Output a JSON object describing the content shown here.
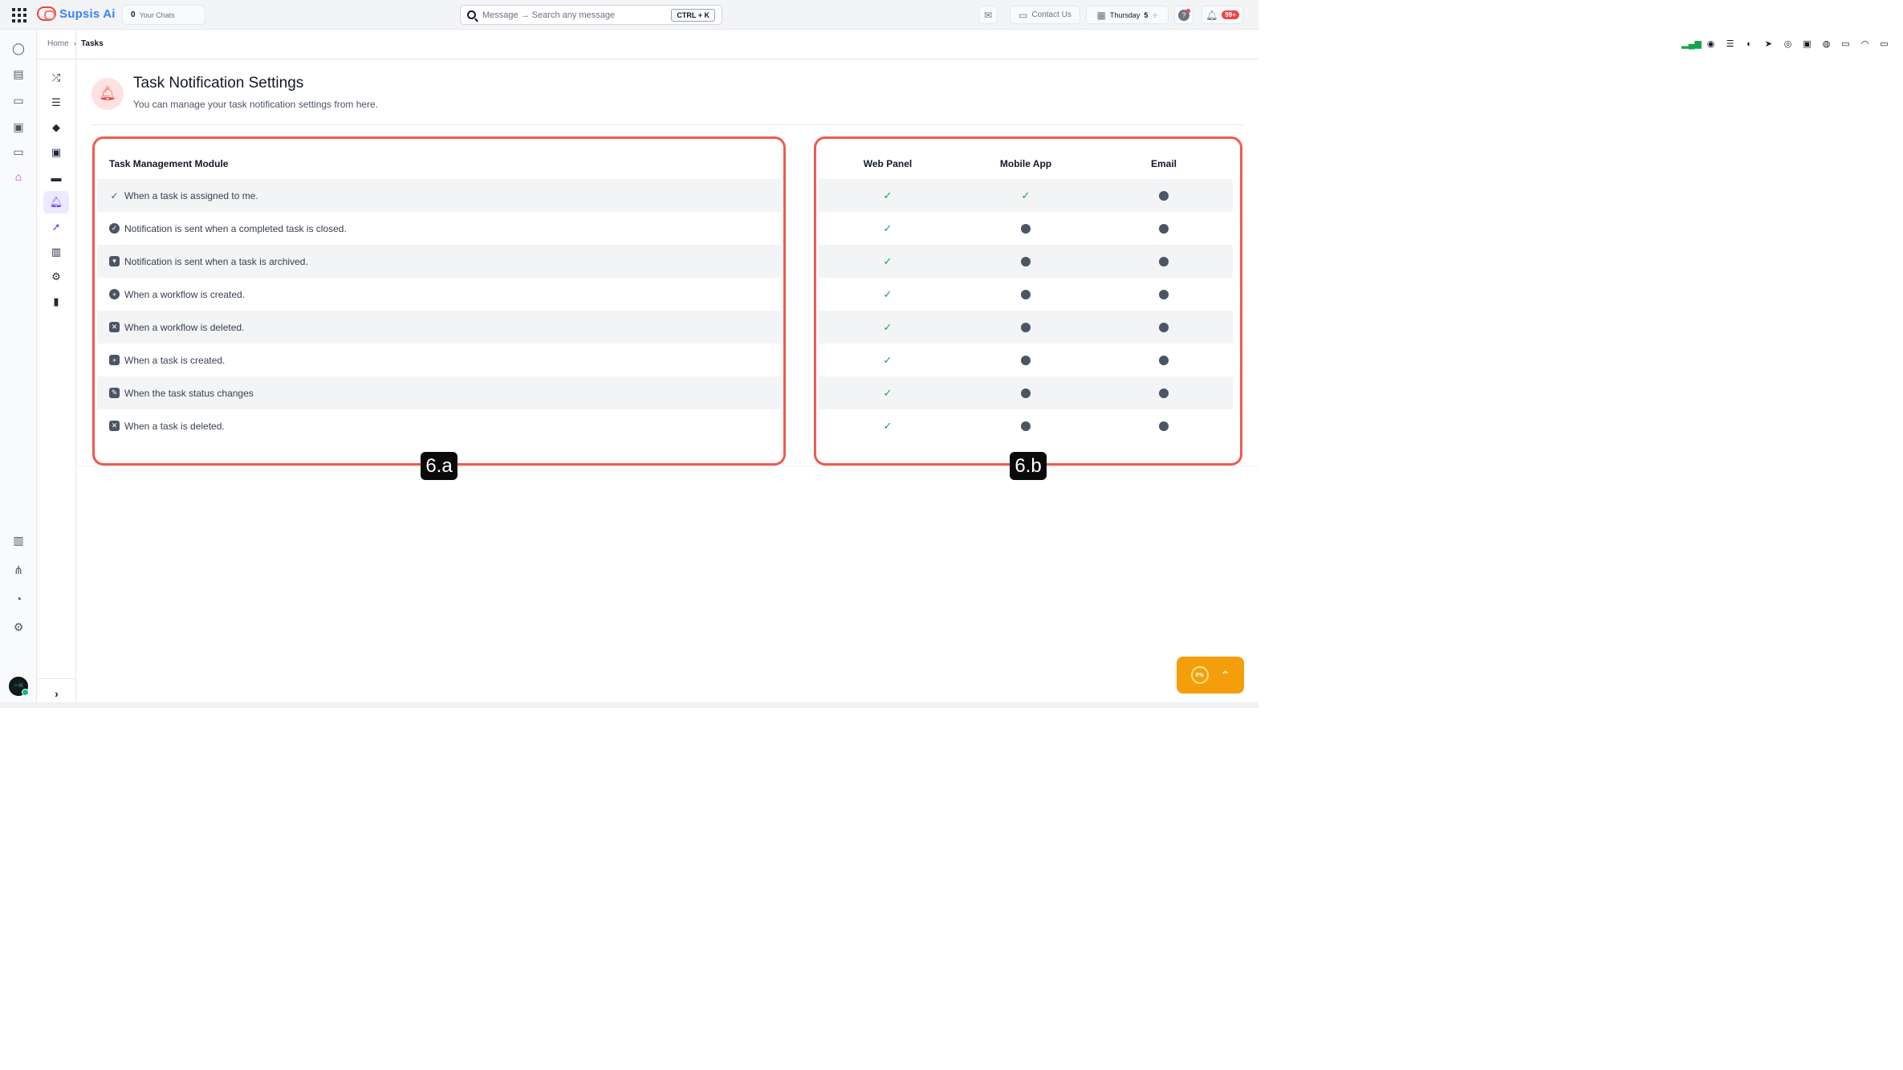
{
  "topbar": {
    "brand": "Supsis Ai",
    "chats_count": "0",
    "chats_label": "Your Chats",
    "search_placeholder": "Message → Search any message",
    "search_shortcut": "CTRL + K",
    "contact_label": "Contact Us",
    "date_day": "Thursday",
    "date_num": "5",
    "notifications_badge": "99+"
  },
  "breadcrumb": {
    "home": "Home",
    "separator": "›",
    "current": "Tasks"
  },
  "channels": [
    "signal-icon",
    "bot-icon",
    "list-icon",
    "users-icon",
    "telegram-icon",
    "whatsapp-icon",
    "instagram-icon",
    "messenger-icon",
    "sms-icon",
    "support-icon",
    "window-icon"
  ],
  "header": {
    "title": "Task Notification Settings",
    "subtitle": "You can manage your task notification settings from here."
  },
  "table": {
    "module_header": "Task Management Module",
    "columns": [
      "Web Panel",
      "Mobile App",
      "Email"
    ],
    "rows": [
      {
        "label": "When a task is assigned to me.",
        "icon": "assign-check-icon",
        "web": true,
        "mobile": true,
        "email": false
      },
      {
        "label": "Notification is sent when a completed task is closed.",
        "icon": "check-circle-icon",
        "web": true,
        "mobile": false,
        "email": false
      },
      {
        "label": "Notification is sent when a task is archived.",
        "icon": "archive-icon",
        "web": true,
        "mobile": false,
        "email": false
      },
      {
        "label": "When a workflow is created.",
        "icon": "plus-circle-icon",
        "web": true,
        "mobile": false,
        "email": false
      },
      {
        "label": "When a workflow is deleted.",
        "icon": "backspace-icon",
        "web": true,
        "mobile": false,
        "email": false
      },
      {
        "label": "When a task is created.",
        "icon": "file-plus-icon",
        "web": true,
        "mobile": false,
        "email": false
      },
      {
        "label": "When the task status changes",
        "icon": "file-edit-icon",
        "web": true,
        "mobile": false,
        "email": false
      },
      {
        "label": "When a task is deleted.",
        "icon": "backspace-icon",
        "web": true,
        "mobile": false,
        "email": false
      }
    ]
  },
  "annotations": {
    "left": "6.a",
    "right": "6.b"
  },
  "progress": {
    "value_text": "0%",
    "value": 0
  },
  "colors": {
    "brand": "#3b82f6",
    "accent": "#9333ea",
    "highlight": "#f05a4f",
    "check": "#16a34a",
    "fab": "#f59e0b"
  }
}
